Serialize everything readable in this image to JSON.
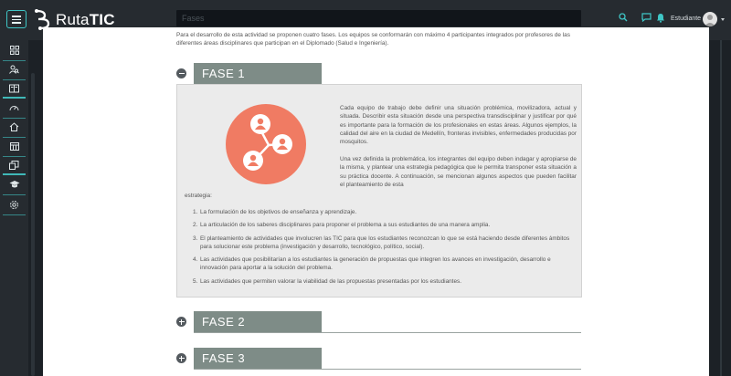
{
  "app": {
    "logo_prefix": "Ruta",
    "logo_bold": "TIC"
  },
  "header": {
    "search_placeholder": "Fases",
    "user_label": "Estudiante"
  },
  "sidebar": {
    "items": [
      {
        "icon": "grid-icon"
      },
      {
        "icon": "user-search-icon"
      },
      {
        "icon": "book-icon"
      },
      {
        "icon": "dashboard-gauge-icon"
      },
      {
        "icon": "home-icon"
      },
      {
        "icon": "calendar-icon"
      },
      {
        "icon": "layers-box-icon"
      },
      {
        "icon": "graduation-cap-icon"
      },
      {
        "icon": "gear-icon"
      }
    ]
  },
  "content": {
    "intro": "Para el desarrollo de esta actividad se proponen cuatro fases. Los equipos se conformarán con máximo 4 participantes integrados por profesores de las diferentes áreas disciplinares que participan en el Diplomado (Salud e Ingeniería).",
    "phases": [
      {
        "label": "FASE 1",
        "expanded": true
      },
      {
        "label": "FASE 2",
        "expanded": false
      },
      {
        "label": "FASE 3",
        "expanded": false
      }
    ],
    "phase1": {
      "paragraph1": "Cada equipo de trabajo debe definir una situación problémica, movilizadora, actual y situada. Describir esta situación desde una perspectiva transdisciplinar y justificar por qué es importante para la formación de los profesionales en estas áreas. Algunos ejemplos, la calidad del aire en la ciudad de Medellín, fronteras invisibles, enfermedades producidas por mosquitos.",
      "paragraph2": "Una vez definida la problemática, los integrantes del equipo deben indagar y apropiarse de la misma, y plantear una estrategia pedagógica que le permita transponer esta situación a su práctica docente. A continuación, se mencionan algunos aspectos que pueden facilitar el planteamiento de esta",
      "paragraph2_end": "estrategia:",
      "list": [
        {
          "num": "1.",
          "text": "La formulación de los objetivos de enseñanza y aprendizaje."
        },
        {
          "num": "2.",
          "text": "La articulación de los saberes disciplinares para proponer el problema a sus estudiantes de una manera amplia."
        },
        {
          "num": "3.",
          "text": "El planteamiento de actividades que involucren las TIC para que los estudiantes reconozcan lo que se está haciendo desde diferentes ámbitos para solucionar este problema (investigación y desarrollo, tecnológico, político, social)."
        },
        {
          "num": "4.",
          "text": "Las actividades que posibilitarían a los estudiantes la generación de propuestas que integren los avances en investigación, desarrollo e innovación para aportar a la solución del problema."
        },
        {
          "num": "5.",
          "text": "Las actividades que permiten valorar la viabilidad de las propuestas presentadas por los estudiantes."
        }
      ]
    }
  },
  "colors": {
    "accent": "#3fc6c6",
    "phase_tab": "#7e8c87",
    "illustration": "#f07b63"
  }
}
